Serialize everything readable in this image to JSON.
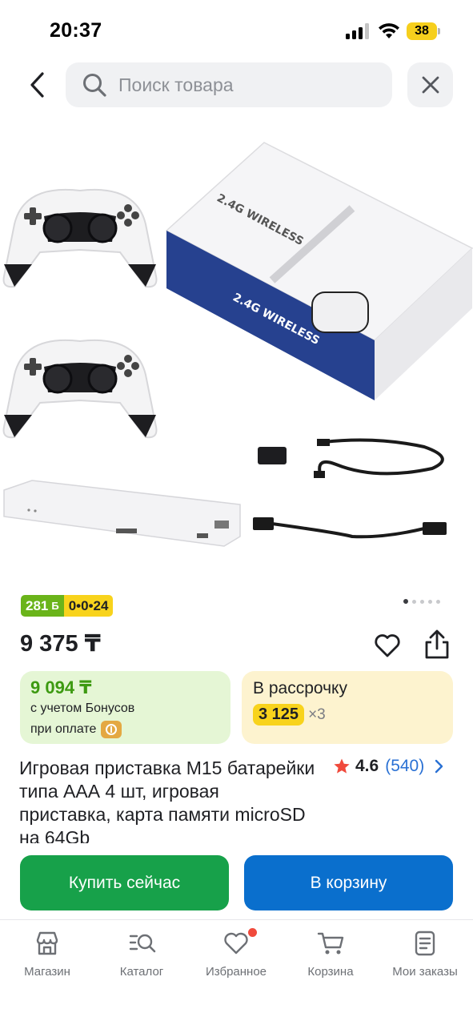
{
  "status_bar": {
    "time": "20:37",
    "battery": "38"
  },
  "search": {
    "placeholder": "Поиск товара"
  },
  "product": {
    "badge_bonus": "281",
    "badge_bonus_symbol": "Б",
    "badge_installment": "0•0•24",
    "price": "9 375 ₸",
    "bonus_card": {
      "amount": "9 094 ₸",
      "line1": "с учетом Бонусов",
      "line2": "при оплате"
    },
    "installment_card": {
      "label": "В рассрочку",
      "amount": "3 125",
      "times": "×3"
    },
    "title": "Игровая приставка M15 батарейки типа ААА 4 шт, игровая приставка, карта памяти microSD на 64Gb",
    "rating": {
      "value": "4.6",
      "count": "(540)"
    },
    "image_text": {
      "box_label": "2.4G WIRELESS"
    }
  },
  "gallery": {
    "total": 5,
    "active": 0
  },
  "actions": {
    "buy_now": "Купить сейчас",
    "add_to_cart": "В корзину"
  },
  "nav": {
    "items": [
      {
        "label": "Магазин",
        "icon": "store-icon"
      },
      {
        "label": "Каталог",
        "icon": "catalog-search-icon"
      },
      {
        "label": "Избранное",
        "icon": "heart-icon"
      },
      {
        "label": "Корзина",
        "icon": "cart-icon"
      },
      {
        "label": "Мои заказы",
        "icon": "orders-icon"
      }
    ]
  },
  "colors": {
    "green": "#17a14a",
    "blue": "#0a6fcd",
    "bonus_green": "#6ab41a",
    "yellow": "#f8d31c",
    "star": "#f04a3c"
  }
}
